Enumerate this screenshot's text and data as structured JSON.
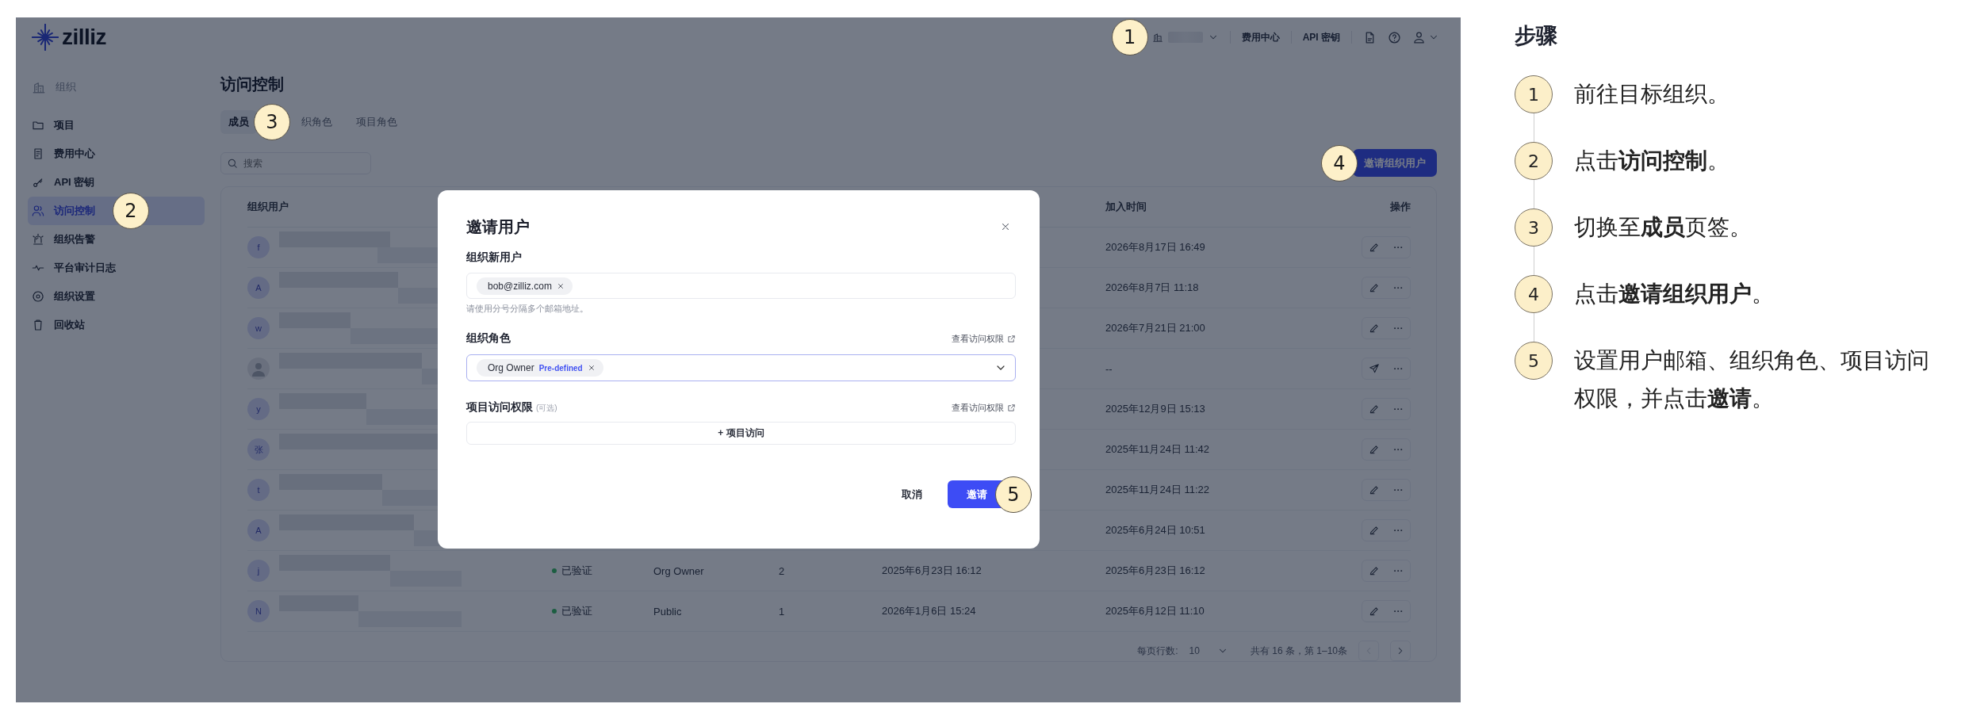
{
  "app": {
    "logo": "zilliz",
    "header": {
      "org_selector": {
        "marker": "1"
      },
      "links": [
        "费用中心",
        "API 密钥"
      ]
    },
    "sidebar": {
      "section": "组织",
      "items": [
        {
          "label": "项目",
          "selected": false
        },
        {
          "label": "费用中心",
          "selected": false
        },
        {
          "label": "API 密钥",
          "selected": false
        },
        {
          "label": "访问控制",
          "selected": true,
          "marker": "2"
        },
        {
          "label": "组织告警",
          "selected": false
        },
        {
          "label": "平台审计日志",
          "selected": false
        },
        {
          "label": "组织设置",
          "selected": false
        },
        {
          "label": "回收站",
          "selected": false
        }
      ]
    },
    "page": {
      "title": "访问控制",
      "tabs": [
        {
          "label": "成员",
          "selected": true,
          "marker": "3"
        },
        {
          "label": "织角色",
          "selected": false
        },
        {
          "label": "项目角色",
          "selected": false
        }
      ],
      "search": {
        "placeholder": "搜索"
      },
      "invite_button": {
        "label": "邀请组织用户",
        "marker": "4"
      },
      "table": {
        "columns": [
          {
            "label": "组织用户"
          },
          {
            "label": "加入时间"
          },
          {
            "label": "操作"
          }
        ],
        "rows": [
          {
            "kind": "edit",
            "avatar": {
              "kind": "letter",
              "letter": "f"
            },
            "joined": "2026年8月17日 16:49"
          },
          {
            "kind": "edit",
            "avatar": {
              "kind": "letter",
              "letter": "A"
            },
            "joined": "2026年8月7日 11:18"
          },
          {
            "kind": "edit",
            "avatar": {
              "kind": "letter",
              "letter": "w"
            },
            "joined": "2026年7月21日 21:00"
          },
          {
            "kind": "send",
            "avatar": {
              "kind": "silhouette"
            },
            "joined": "--"
          },
          {
            "kind": "edit",
            "avatar": {
              "kind": "letter",
              "letter": "y"
            },
            "joined": "2025年12月9日 15:13"
          },
          {
            "kind": "edit",
            "avatar": {
              "kind": "letter",
              "letter": "张"
            },
            "joined": "2025年11月24日 11:42"
          },
          {
            "kind": "edit",
            "avatar": {
              "kind": "letter",
              "letter": "t"
            },
            "joined": "2025年11月24日 11:22"
          },
          {
            "kind": "edit",
            "avatar": {
              "kind": "letter",
              "letter": "A"
            },
            "joined": "2025年6月24日 10:51"
          },
          {
            "kind": "edit",
            "avatar": {
              "kind": "letter",
              "letter": "j"
            },
            "status": "已验证",
            "role": "Org Owner",
            "column_4": "2",
            "column_5": "2025年6月23日 16:12",
            "joined": "2025年6月23日 16:12"
          },
          {
            "kind": "edit",
            "avatar": {
              "kind": "letter",
              "letter": "N"
            },
            "status": "已验证",
            "role": "Public",
            "column_4": "1",
            "column_5": "2026年1月6日 15:24",
            "joined": "2025年6月12日 11:10"
          }
        ]
      },
      "pagination": {
        "rows_label": "每页行数:",
        "rows_per_page": "10",
        "summary": "共有 16 条，第 1–10条",
        "prev_disabled": true,
        "next_disabled": false
      }
    },
    "modal": {
      "title": "邀请用户",
      "new_users": {
        "label": "组织新用户",
        "emails": [
          "bob@zilliz.com"
        ],
        "hint": "请使用分号分隔多个邮箱地址。"
      },
      "role": {
        "label": "组织角色",
        "link": "查看访问权限",
        "chips": [
          {
            "name": "Org Owner",
            "tag": "Pre-defined"
          }
        ]
      },
      "project_access": {
        "label": "项目访问权限",
        "optional": "(可选)",
        "link": "查看访问权限",
        "add_button": "+ 项目访问"
      },
      "cancel": "取消",
      "submit": {
        "label": "邀请",
        "marker": "5"
      }
    }
  },
  "steps": {
    "title": "步骤",
    "items": [
      {
        "number": "1",
        "text": "前往目标组织。"
      },
      {
        "number": "2",
        "text": "点击**访问控制**。"
      },
      {
        "number": "3",
        "text": "切换至**成员**页签。"
      },
      {
        "number": "4",
        "text": "点击**邀请组织用户**。"
      },
      {
        "number": "5",
        "text": "设置用户邮箱、组织角色、项目访问权限，并点击**邀请**。"
      }
    ]
  }
}
